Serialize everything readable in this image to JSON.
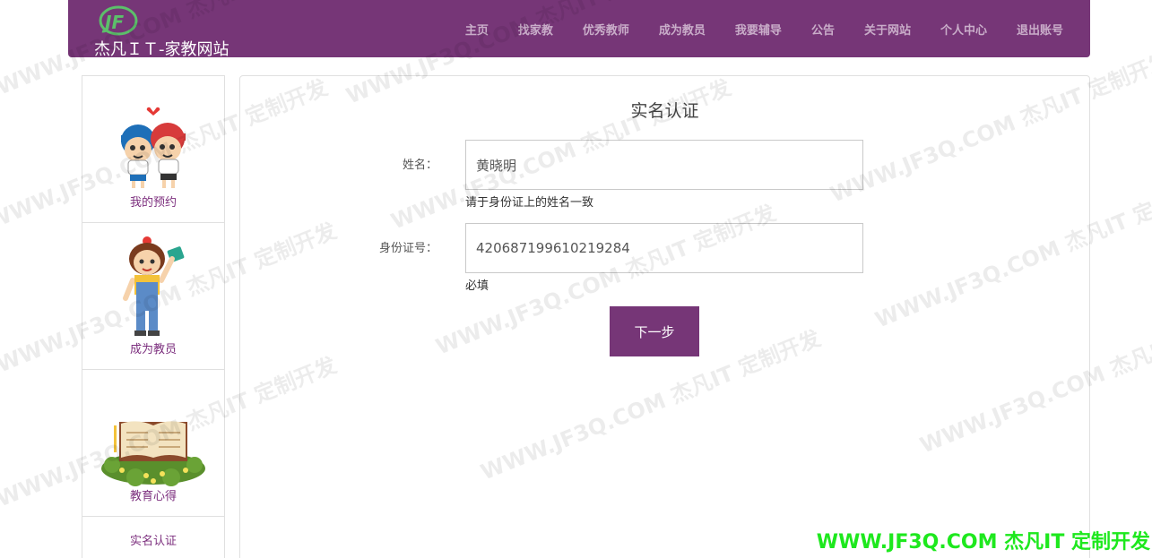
{
  "header": {
    "brand_title": "杰凡ＩＴ-家教网站",
    "logo_text": "JF",
    "nav": [
      "主页",
      "找家教",
      "优秀教师",
      "成为教员",
      "我要辅导",
      "公告",
      "关于网站",
      "个人中心",
      "退出账号"
    ]
  },
  "sidebar": {
    "items": [
      {
        "label": "我的预约",
        "icon": "kids-couple-illustration"
      },
      {
        "label": "成为教员",
        "icon": "girl-with-book-illustration"
      },
      {
        "label": "教育心得",
        "icon": "open-book-illustration"
      },
      {
        "label": "实名认证",
        "icon": ""
      }
    ]
  },
  "form": {
    "title": "实名认证",
    "name_label": "姓名：",
    "name_value": "黄晓明",
    "name_hint": "请于身份证上的姓名一致",
    "id_label": "身份证号：",
    "id_value": "420687199610219284",
    "id_hint": "必填",
    "next_button": "下一步"
  },
  "watermark": {
    "text": "WWW.JF3Q.COM 杰凡IT  定制开发",
    "bottom_text": "WWW.JF3Q.COM 杰凡IT  定制开发"
  },
  "colors": {
    "brand": "#763677",
    "nav_text": "#c9adc9",
    "sidebar_label": "#7c2f7e",
    "bottom_mark": "#1ee81e"
  }
}
